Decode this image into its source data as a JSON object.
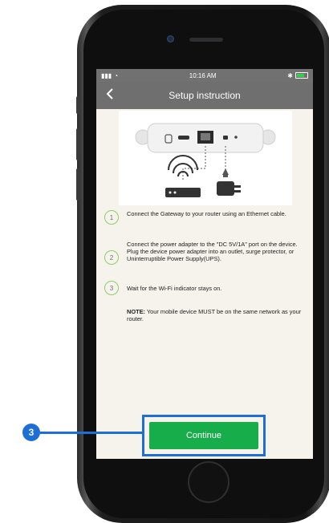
{
  "status_bar": {
    "time": "10:16 AM"
  },
  "nav": {
    "title": "Setup instruction"
  },
  "steps": [
    {
      "number": "1",
      "text": "Connect the Gateway to your router using an Ethernet cable."
    },
    {
      "number": "2",
      "text": "Connect the power adapter to the \"DC 5V/1A\" port on the device. Plug the device power adapter into an outlet, surge protector, or Uninterruptible Power Supply(UPS)."
    },
    {
      "number": "3",
      "text": "Wait for the Wi-Fi indicator stays on."
    }
  ],
  "note": {
    "label": "NOTE:",
    "text": "Your mobile device MUST be on the same network as your router."
  },
  "continue_button": {
    "label": "Continue"
  },
  "annotation": {
    "callout_number": "3"
  },
  "colors": {
    "accent": "#18ad4b",
    "annotation": "#1d6fd6",
    "nav": "#6f6f6f",
    "screen_bg": "#f6f3ec"
  }
}
